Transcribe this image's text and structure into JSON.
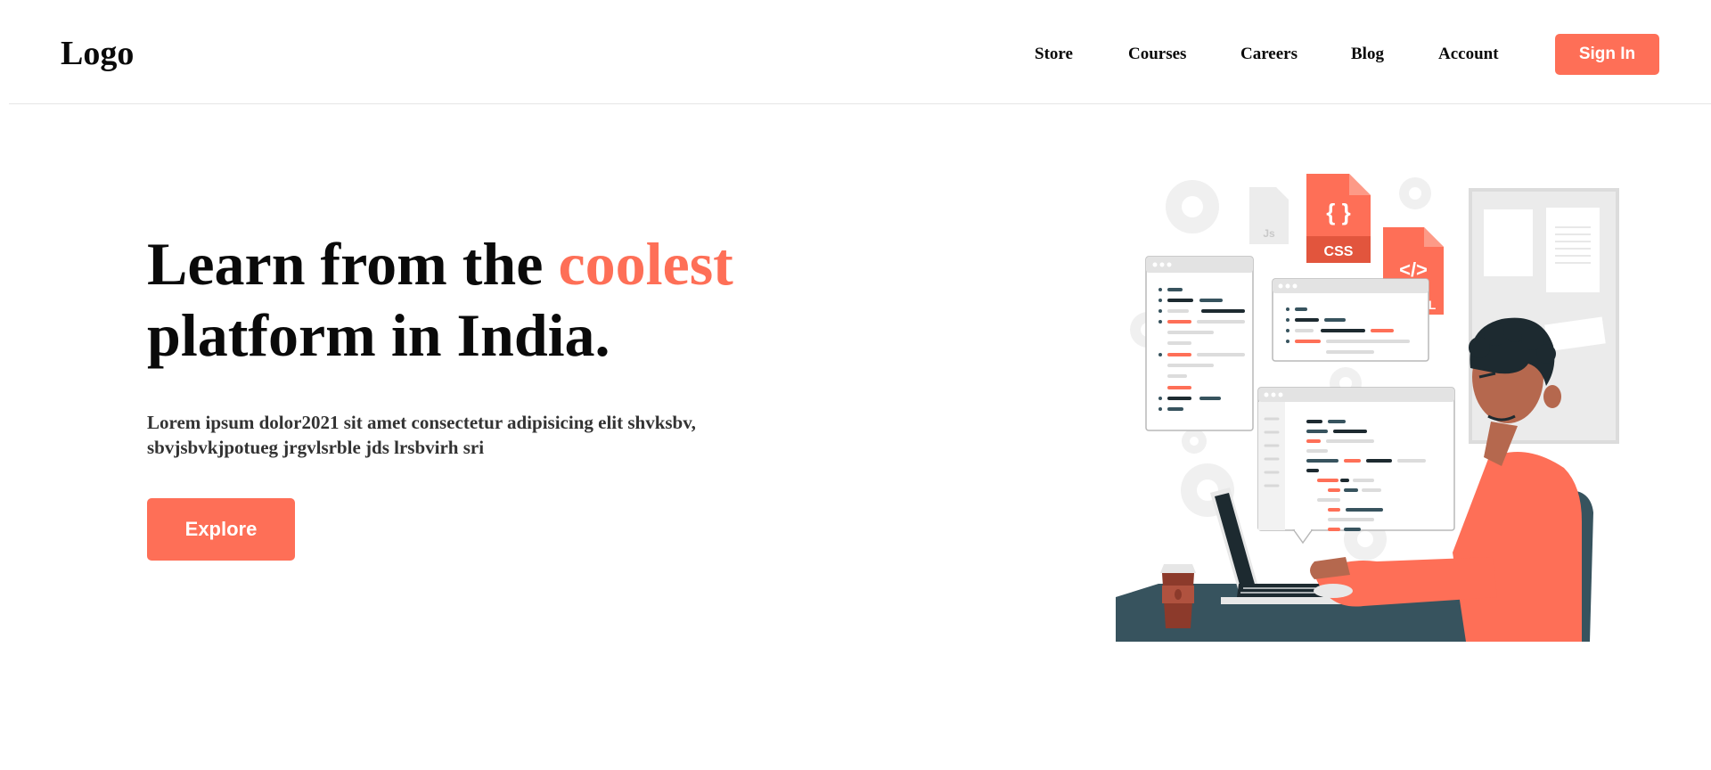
{
  "header": {
    "logo": "Logo",
    "nav": [
      "Store",
      "Courses",
      "Careers",
      "Blog",
      "Account"
    ],
    "signin_label": "Sign In"
  },
  "hero": {
    "title_before": "Learn from the ",
    "title_accent": "coolest",
    "title_after": "platform in India.",
    "description": "Lorem ipsum dolor2021 sit amet consectetur adipisicing elit shvksbv, sbvjsbvkjpotueg jrgvlsrble jds lrsbvirh sri",
    "explore_label": "Explore"
  },
  "illustration": {
    "file_css": "CSS",
    "file_html_partial": "HL",
    "file_js": "Js"
  },
  "colors": {
    "accent": "#fe6f57",
    "dark_slate": "#37535e"
  }
}
